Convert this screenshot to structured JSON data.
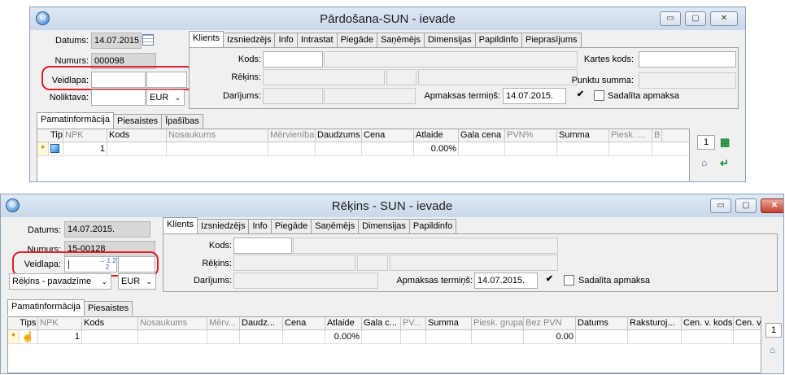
{
  "top": {
    "title": "Pārdošana-SUN - ievade",
    "controls": {
      "minimize": "▭",
      "maximize": "▢",
      "close": "✕"
    },
    "fields": {
      "datums_label": "Datums:",
      "datums_value": "14.07.2015",
      "numurs_label": "Numurs:",
      "numurs_value": "000098",
      "veidlapa_label": "Veidlapa:",
      "noliktava_label": "Noliktava:",
      "currency": "EUR"
    },
    "tabs": [
      "Klients",
      "Izsniedzējs",
      "Info",
      "Intrastat",
      "Piegāde",
      "Saņēmējs",
      "Dimensijas",
      "Papildinfo",
      "Pieprasījums"
    ],
    "client": {
      "kods_label": "Kods:",
      "rekins_label": "Rēķins:",
      "darijums_label": "Darījums:",
      "kartes_kods_label": "Kartes kods:",
      "punktu_summa_label": "Punktu summa:",
      "apmaksas_termins_label": "Apmaksas termiņš:",
      "apmaksas_termins_value": "14.07.2015.",
      "sadalita_label": "Sadalīta apmaksa"
    },
    "lower_tabs": [
      "Pamatinformācija",
      "Piesaistes",
      "Īpašības"
    ],
    "grid": {
      "headers": [
        "Tips",
        "NPK",
        "Kods",
        "Nosaukums",
        "Mērvienība",
        "Daudzums",
        "Cena",
        "Atlaide",
        "Gala cena",
        "PVN%",
        "Summa",
        "Piesk. ...",
        "B"
      ],
      "row": {
        "marker": "*",
        "npk": "1",
        "atlaide": "0.00%"
      }
    },
    "side_count": "1"
  },
  "bottom": {
    "title": "Rēķins - SUN - ievade",
    "controls": {
      "minimize": "▭",
      "maximize": "▢",
      "close": "✕"
    },
    "fields": {
      "datums_label": "Datums:",
      "datums_value": "14.07.2015.",
      "numurs_label": "Numurs:",
      "numurs_value": "15-00128",
      "veidlapa_label": "Veidlapa:",
      "veidlapa_value": "|",
      "doc_type": "Rēķins - pavadzīme",
      "currency": "EUR",
      "picker_icon": "→ 1 2 2"
    },
    "tabs": [
      "Klients",
      "Izsniedzējs",
      "Info",
      "Piegāde",
      "Saņēmējs",
      "Dimensijas",
      "Papildinfo"
    ],
    "client": {
      "kods_label": "Kods:",
      "rekins_label": "Rēķins:",
      "darijums_label": "Darījums:",
      "apmaksas_termins_label": "Apmaksas termiņš:",
      "apmaksas_termins_value": "14.07.2015.",
      "sadalita_label": "Sadalīta apmaksa"
    },
    "lower_tabs": [
      "Pamatinformācija",
      "Piesaistes"
    ],
    "grid": {
      "headers": [
        "Tips",
        "NPK",
        "Kods",
        "Nosaukums",
        "Mērv...",
        "Daudz...",
        "Cena",
        "Atlaide",
        "Gala c...",
        "PV...",
        "Summa",
        "Piesk. grupa",
        "Bez PVN",
        "Datums",
        "Raksturoj...",
        "Cen. v. kods",
        "Cen. v"
      ],
      "row": {
        "marker": "*",
        "npk": "1",
        "atlaide": "0.00%",
        "bez_pvn": "0.00"
      }
    },
    "side_count": "1"
  }
}
